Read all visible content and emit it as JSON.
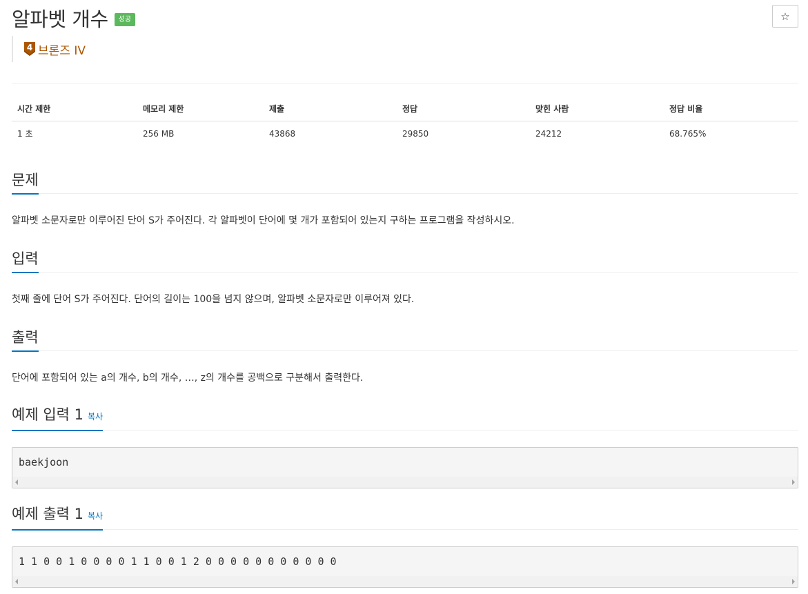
{
  "problem": {
    "title": "알파벳 개수",
    "result_badge": "성공",
    "star_label": "☆",
    "tier": {
      "level": "4",
      "name": "브론즈 IV"
    }
  },
  "info_table": {
    "headers": [
      "시간 제한",
      "메모리 제한",
      "제출",
      "정답",
      "맞힌 사람",
      "정답 비율"
    ],
    "values": [
      "1 초",
      "256 MB",
      "43868",
      "29850",
      "24212",
      "68.765%"
    ]
  },
  "sections": {
    "description": {
      "title": "문제",
      "text": "알파벳 소문자로만 이루어진 단어 S가 주어진다. 각 알파벳이 단어에 몇 개가 포함되어 있는지 구하는 프로그램을 작성하시오."
    },
    "input": {
      "title": "입력",
      "text": "첫째 줄에 단어 S가 주어진다. 단어의 길이는 100을 넘지 않으며, 알파벳 소문자로만 이루어져 있다."
    },
    "output": {
      "title": "출력",
      "text": "단어에 포함되어 있는 a의 개수, b의 개수, …, z의 개수를 공백으로 구분해서 출력한다."
    },
    "sample_input": {
      "title": "예제 입력 1",
      "copy_label": "복사",
      "content": "baekjoon"
    },
    "sample_output": {
      "title": "예제 출력 1",
      "copy_label": "복사",
      "content": "1 1 0 0 1 0 0 0 0 1 1 0 0 1 2 0 0 0 0 0 0 0 0 0 0 0"
    }
  },
  "colors": {
    "accent": "#0076c0",
    "badge": "#5cb85c",
    "tier": "#ad5600"
  }
}
